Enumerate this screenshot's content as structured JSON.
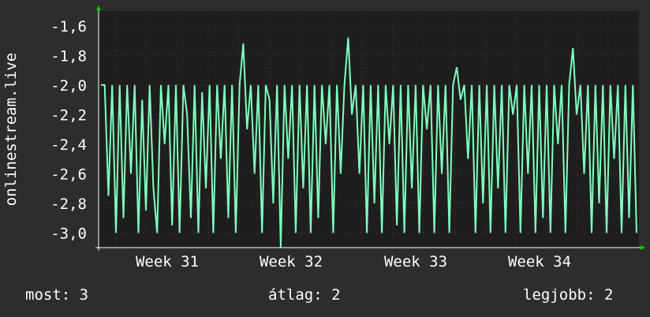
{
  "chart_data": {
    "type": "line",
    "ylabel": "onlinestream.live",
    "ylim": [
      -3.1,
      -1.5
    ],
    "yticks": [
      -1.6,
      -1.8,
      -2.0,
      -2.2,
      -2.4,
      -2.6,
      -2.8,
      -3.0
    ],
    "ytick_labels": [
      "-1,6",
      "-1,8",
      "-2,0",
      "-2,2",
      "-2,4",
      "-2,6",
      "-2,8",
      "-3,0"
    ],
    "xticks": [
      "Week 31",
      "Week 32",
      "Week 33",
      "Week 34"
    ],
    "grid": true,
    "colors": {
      "background": "#2d2d2d",
      "plot": "#1e1e1e",
      "line": "#7fffbf",
      "grid": "#7a2020",
      "axis": "#00cc00"
    },
    "series": [
      {
        "values": [
          -2.0,
          -2.0,
          -2.75,
          -2.0,
          -3.0,
          -2.0,
          -2.9,
          -2.0,
          -2.6,
          -2.0,
          -3.0,
          -2.1,
          -2.85,
          -2.0,
          -2.7,
          -3.0,
          -2.0,
          -2.4,
          -2.0,
          -2.95,
          -2.0,
          -3.0,
          -2.0,
          -2.2,
          -2.9,
          -2.0,
          -3.0,
          -2.05,
          -2.7,
          -2.0,
          -3.0,
          -2.0,
          -2.5,
          -2.0,
          -2.9,
          -2.0,
          -3.0,
          -2.0,
          -1.72,
          -2.3,
          -2.0,
          -2.6,
          -2.0,
          -3.0,
          -2.0,
          -2.1,
          -2.8,
          -2.0,
          -3.1,
          -2.0,
          -2.5,
          -2.0,
          -3.0,
          -2.0,
          -2.7,
          -2.0,
          -3.0,
          -2.0,
          -2.9,
          -2.0,
          -2.4,
          -2.0,
          -3.0,
          -2.0,
          -2.6,
          -2.0,
          -1.68,
          -2.2,
          -2.0,
          -2.6,
          -2.0,
          -3.0,
          -2.0,
          -2.8,
          -2.0,
          -3.0,
          -2.0,
          -2.4,
          -2.0,
          -2.95,
          -2.0,
          -3.0,
          -2.0,
          -2.7,
          -2.0,
          -3.0,
          -2.0,
          -2.3,
          -2.0,
          -3.0,
          -2.0,
          -2.6,
          -2.0,
          -3.0,
          -2.0,
          -1.88,
          -2.1,
          -2.0,
          -2.5,
          -2.0,
          -3.0,
          -2.0,
          -2.8,
          -2.0,
          -3.0,
          -2.0,
          -2.7,
          -2.0,
          -3.0,
          -2.0,
          -2.2,
          -2.0,
          -3.0,
          -2.0,
          -2.6,
          -2.0,
          -3.0,
          -2.0,
          -2.9,
          -2.0,
          -3.0,
          -2.0,
          -2.4,
          -2.0,
          -3.0,
          -2.0,
          -1.75,
          -2.2,
          -2.0,
          -2.6,
          -2.0,
          -3.0,
          -2.0,
          -2.8,
          -2.0,
          -3.0,
          -2.0,
          -2.5,
          -2.0,
          -3.0,
          -2.0,
          -2.9,
          -2.0,
          -3.0
        ]
      }
    ]
  },
  "footer": {
    "current": "most: 3",
    "average": "átlag: 2",
    "best": "legjobb: 2"
  }
}
